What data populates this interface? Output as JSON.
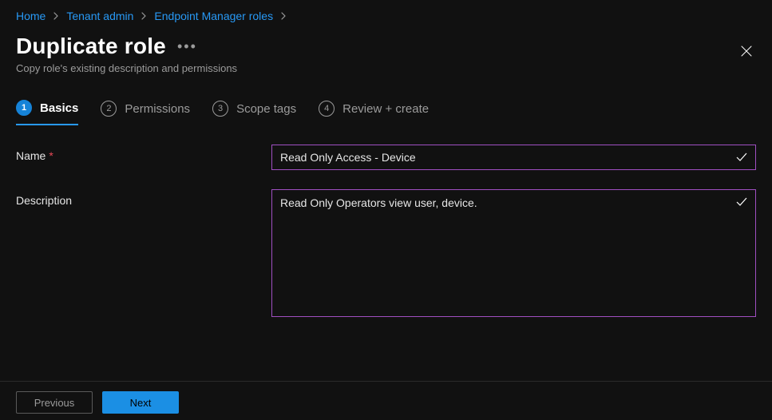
{
  "breadcrumb": {
    "items": [
      {
        "label": "Home"
      },
      {
        "label": "Tenant admin"
      },
      {
        "label": "Endpoint Manager roles"
      }
    ]
  },
  "header": {
    "title": "Duplicate role",
    "subtitle": "Copy role's existing description and permissions"
  },
  "steps": [
    {
      "num": "1",
      "label": "Basics",
      "active": true
    },
    {
      "num": "2",
      "label": "Permissions",
      "active": false
    },
    {
      "num": "3",
      "label": "Scope tags",
      "active": false
    },
    {
      "num": "4",
      "label": "Review + create",
      "active": false
    }
  ],
  "form": {
    "name_label": "Name",
    "name_value": "Read Only Access - Device",
    "description_label": "Description",
    "description_value": "Read Only Operators view user, device."
  },
  "footer": {
    "previous": "Previous",
    "next": "Next"
  }
}
